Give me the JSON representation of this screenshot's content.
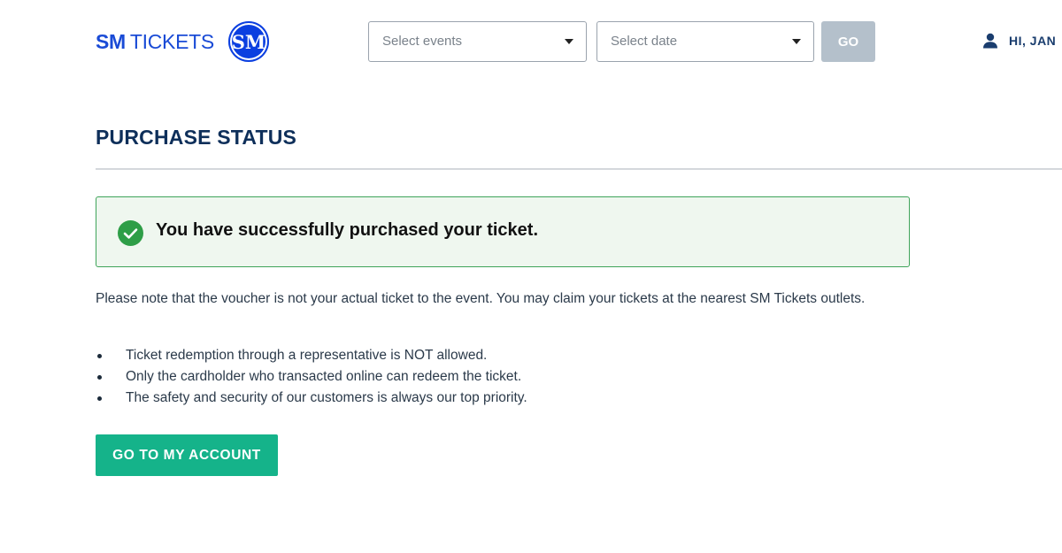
{
  "header": {
    "logo": {
      "primary": "SM",
      "secondary": "TICKETS",
      "badge_text": "SM",
      "color": "#1a4bd6",
      "badge_color": "#0b3fe0"
    },
    "events_select": {
      "placeholder": "Select events"
    },
    "date_select": {
      "placeholder": "Select date"
    },
    "go_label": "GO",
    "user": {
      "icon": "user-icon",
      "greeting": "HI, JAN"
    }
  },
  "main": {
    "title": "PURCHASE STATUS",
    "success": {
      "icon": "check-circle-icon",
      "message": "You have successfully purchased your ticket.",
      "accent": "#2e9e47"
    },
    "note": "Please note that the voucher is not your actual ticket to the event. You may claim your tickets at the nearest SM Tickets outlets.",
    "bullets": [
      "Ticket redemption through a representative is NOT allowed.",
      "Only the cardholder who transacted online can redeem the ticket.",
      "The safety and security of our customers is always our top priority."
    ],
    "account_button": {
      "label": "GO TO MY ACCOUNT",
      "color": "#15b38a"
    }
  }
}
